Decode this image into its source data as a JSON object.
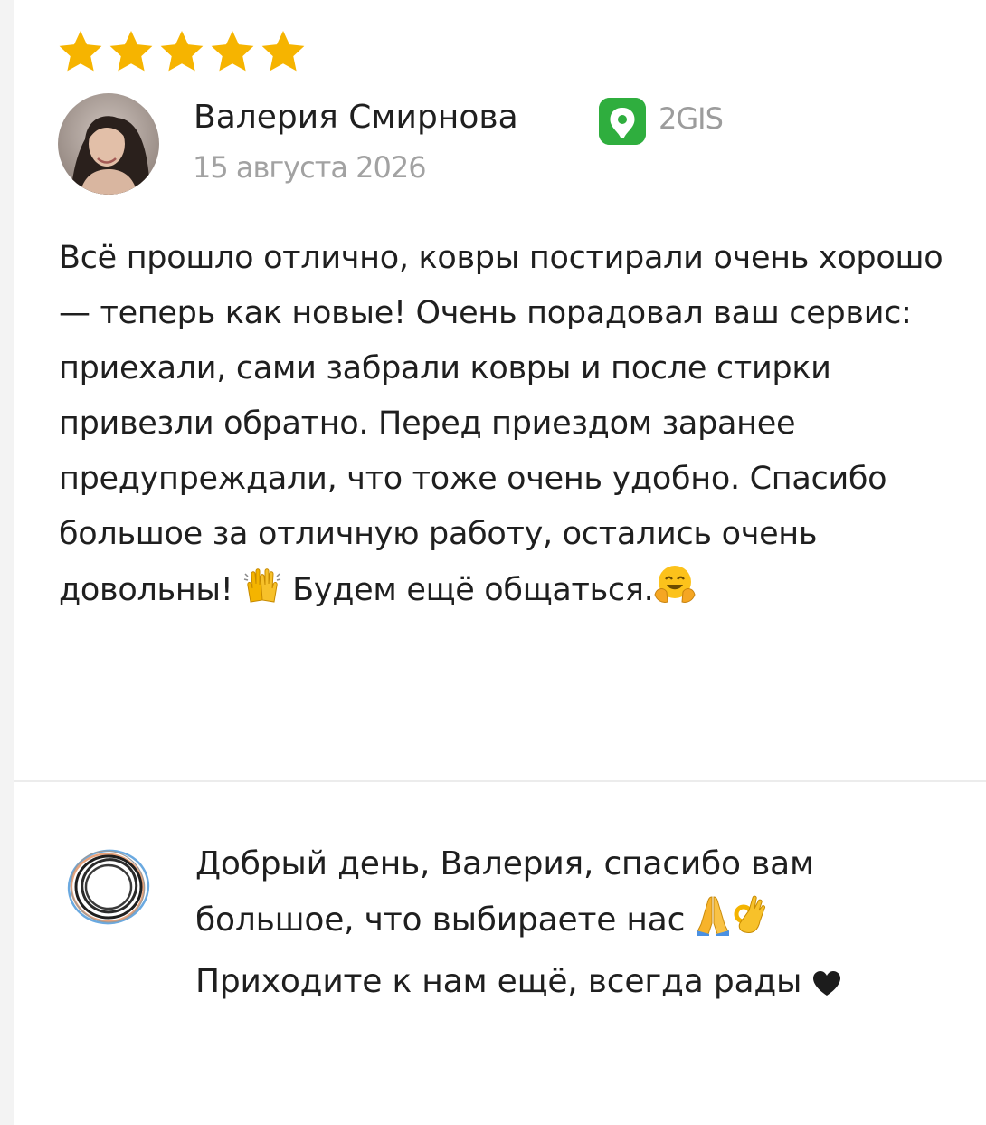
{
  "review": {
    "rating": 5,
    "rating_max": 5,
    "author_name": "Валерия Смирнова",
    "source_name": "2GIS",
    "date": "15 августа 2026",
    "text_part1": "Всё прошло отлично, ковры постирали очень хорошо — теперь как новые! Очень порадовал ваш сервис: приехали, сами забрали ковры и после стирки привезли обратно. Перед приездом заранее предупреждали, что тоже очень удобно. Спасибо большое за отличную работу, остались очень довольны! ",
    "emoji_1": "raising-hands",
    "text_part2": " Будем ещё общаться.",
    "emoji_2": "hugging-face"
  },
  "reply": {
    "text_part1": "Добрый день, Валерия, спасибо вам большое, что выбираете нас ",
    "emoji_1": "folded-hands",
    "emoji_2": "ok-hand",
    "text_part2": " Приходите к нам ещё, всегда рады ",
    "emoji_3": "heart"
  },
  "colors": {
    "star": "#f6b400",
    "source_logo": "#2fae3e",
    "muted_text": "#9c9c9c"
  }
}
